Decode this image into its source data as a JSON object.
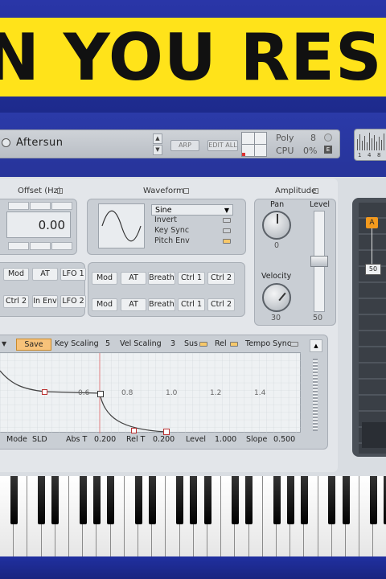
{
  "banner": {
    "text": "N YOU RESIS"
  },
  "header": {
    "preset_name": "Aftersun",
    "arp_label": "ARP",
    "edit_all_label": "EDIT ALL",
    "poly_label": "Poly",
    "poly_value": "8",
    "cpu_label": "CPU",
    "cpu_value": "0%",
    "right_box_labels": [
      "1",
      "4",
      "8"
    ]
  },
  "offset": {
    "title": "Offset (Hz)",
    "value": "0.00"
  },
  "waveform": {
    "title": "Waveform",
    "select_value": "Sine",
    "options": [
      "Invert",
      "Key Sync",
      "Pitch Env"
    ]
  },
  "amplitude": {
    "title": "Amplitude",
    "pan_label": "Pan",
    "pan_value": "0",
    "level_label": "Level",
    "level_value": "50",
    "velocity_label": "Velocity",
    "velocity_value": "30"
  },
  "mod_row1_left": [
    "Mod",
    "AT",
    "LFO 1"
  ],
  "mod_row2_left": [
    "Ctrl 2",
    "In Env",
    "LFO 2"
  ],
  "mod_row1_right": [
    "Mod",
    "AT",
    "Breath",
    "Ctrl 1",
    "Ctrl 2"
  ],
  "mod_row2_right": [
    "Mod",
    "AT",
    "Breath",
    "Ctrl 1",
    "Ctrl 2"
  ],
  "envelope": {
    "save_label": "Save",
    "key_scaling_label": "Key Scaling",
    "key_scaling_value": "5",
    "vel_scaling_label": "Vel Scaling",
    "vel_scaling_value": "3",
    "sus_label": "Sus",
    "rel_label": "Rel",
    "tempo_sync_label": "Tempo Sync",
    "grid_labels": [
      "0.6",
      "0.8",
      "1.0",
      "1.2",
      "1.4"
    ],
    "bottom": {
      "mode_label": "Mode",
      "mode_value": "SLD",
      "abs_t_label": "Abs T",
      "abs_t_value": "0.200",
      "rel_t_label": "Rel T",
      "rel_t_value": "0.200",
      "level_label": "Level",
      "level_value": "1.000",
      "slope_label": "Slope",
      "slope_value": "0.500"
    }
  },
  "side_panel": {
    "badge": "A",
    "value": "50"
  },
  "colors": {
    "banner": "#ffe31a",
    "accent_orange": "#f39a1e",
    "frame_blue": "#1d2a8c"
  }
}
